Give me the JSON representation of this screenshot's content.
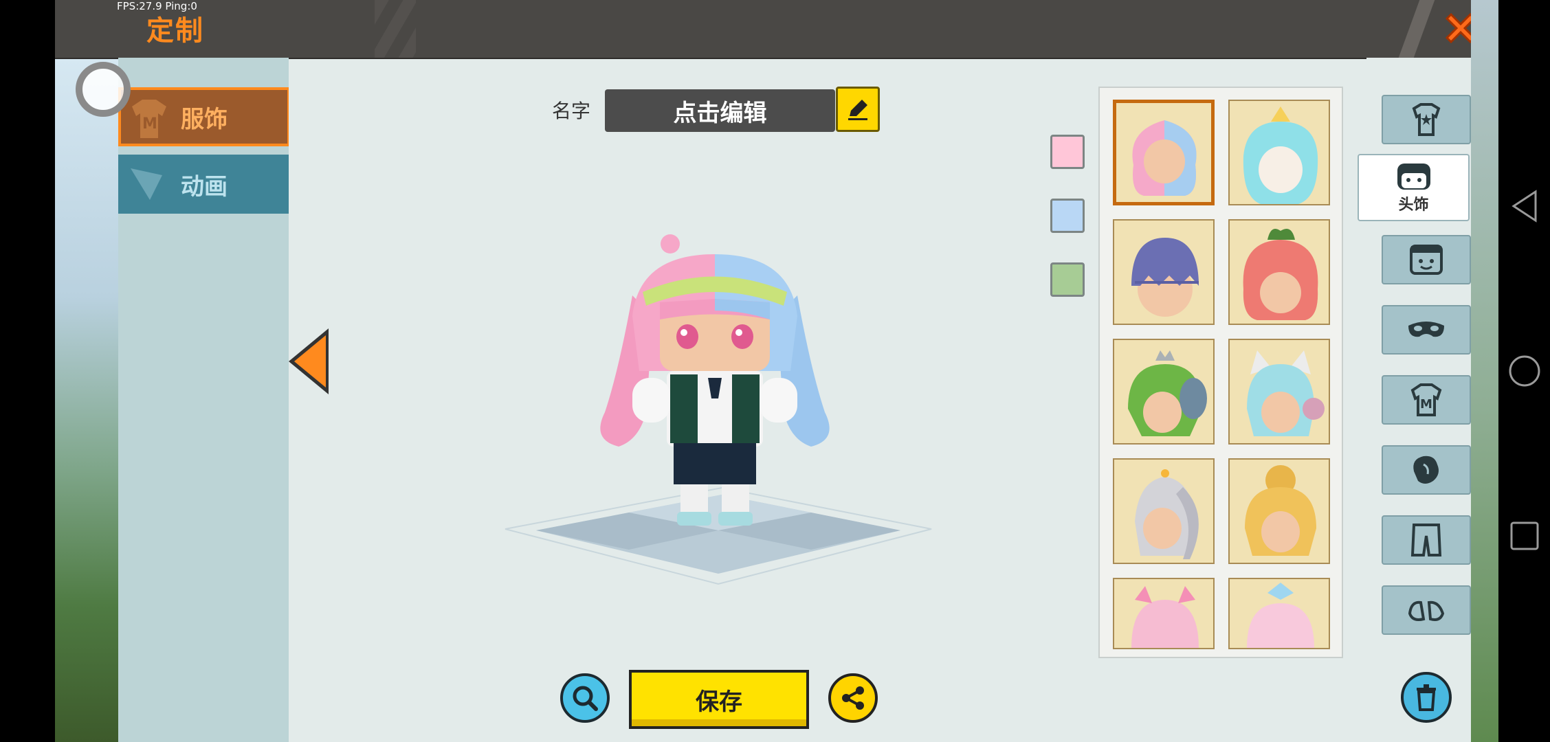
{
  "debug": {
    "fps_text": "FPS:27.9  Ping:0"
  },
  "header": {
    "title": "定制"
  },
  "left_tabs": [
    {
      "label": "服饰",
      "selected": true
    },
    {
      "label": "动画",
      "selected": false
    }
  ],
  "name_editor": {
    "label": "名字",
    "value": "点击编辑"
  },
  "color_swatches": [
    "#ffc6d8",
    "#b9d7f5",
    "#a7cc95"
  ],
  "actions": {
    "save_label": "保存"
  },
  "right_categories": [
    {
      "icon": "outfit-icon",
      "label": ""
    },
    {
      "icon": "headwear-icon",
      "label": "头饰",
      "selected": true
    },
    {
      "icon": "face-icon",
      "label": ""
    },
    {
      "icon": "mask-icon",
      "label": ""
    },
    {
      "icon": "shirt-icon",
      "label": ""
    },
    {
      "icon": "gloves-icon",
      "label": ""
    },
    {
      "icon": "pants-icon",
      "label": ""
    },
    {
      "icon": "shoes-icon",
      "label": ""
    }
  ],
  "headwear_items": [
    {
      "hair": "pink-blue",
      "selected": true
    },
    {
      "hair": "cyan-crown",
      "selected": false
    },
    {
      "hair": "purple-cap",
      "selected": false
    },
    {
      "hair": "red-peach",
      "selected": false
    },
    {
      "hair": "green-fish",
      "selected": false
    },
    {
      "hair": "cat-headphones",
      "selected": false
    },
    {
      "hair": "silver-ponytail",
      "selected": false
    },
    {
      "hair": "golden-bun",
      "selected": false
    },
    {
      "hair": "pink-bow",
      "selected": false
    },
    {
      "hair": "blue-crown",
      "selected": false
    }
  ]
}
